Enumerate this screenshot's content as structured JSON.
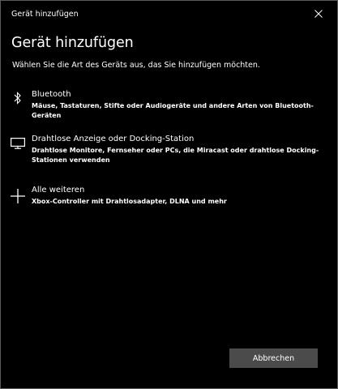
{
  "window": {
    "title": "Gerät hinzufügen"
  },
  "heading": "Gerät hinzufügen",
  "subtitle": "Wählen Sie die Art des Geräts aus, das Sie hinzufügen möchten.",
  "options": [
    {
      "icon": "bluetooth-icon",
      "title": "Bluetooth",
      "description": "Mäuse, Tastaturen, Stifte oder Audiogeräte und andere Arten von Bluetooth-Geräten"
    },
    {
      "icon": "monitor-icon",
      "title": "Drahtlose Anzeige oder Docking-Station",
      "description": "Drahtlose Monitore, Fernseher oder PCs, die Miracast oder drahtlose Docking-Stationen verwenden"
    },
    {
      "icon": "plus-icon",
      "title": "Alle weiteren",
      "description": "Xbox-Controller mit Drahtlosadapter, DLNA und mehr"
    }
  ],
  "buttons": {
    "cancel_label": "Abbrechen"
  },
  "colors": {
    "background": "#000000",
    "border": "#5a5a5a",
    "text": "#ffffff",
    "button_background": "#4b4b4b"
  }
}
